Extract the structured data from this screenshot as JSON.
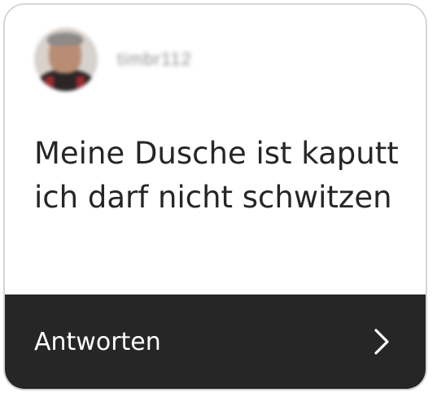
{
  "card": {
    "username": "timbr112",
    "question": "Meine Dusche ist kaputt ich darf nicht schwitzen",
    "reply_label": "Antworten"
  },
  "icons": {
    "avatar": "profile-photo",
    "chevron": "chevron-right-icon"
  },
  "colors": {
    "footer_background": "#262626",
    "text": "#262626",
    "footer_text": "#ffffff",
    "border": "#d6d6d6"
  }
}
